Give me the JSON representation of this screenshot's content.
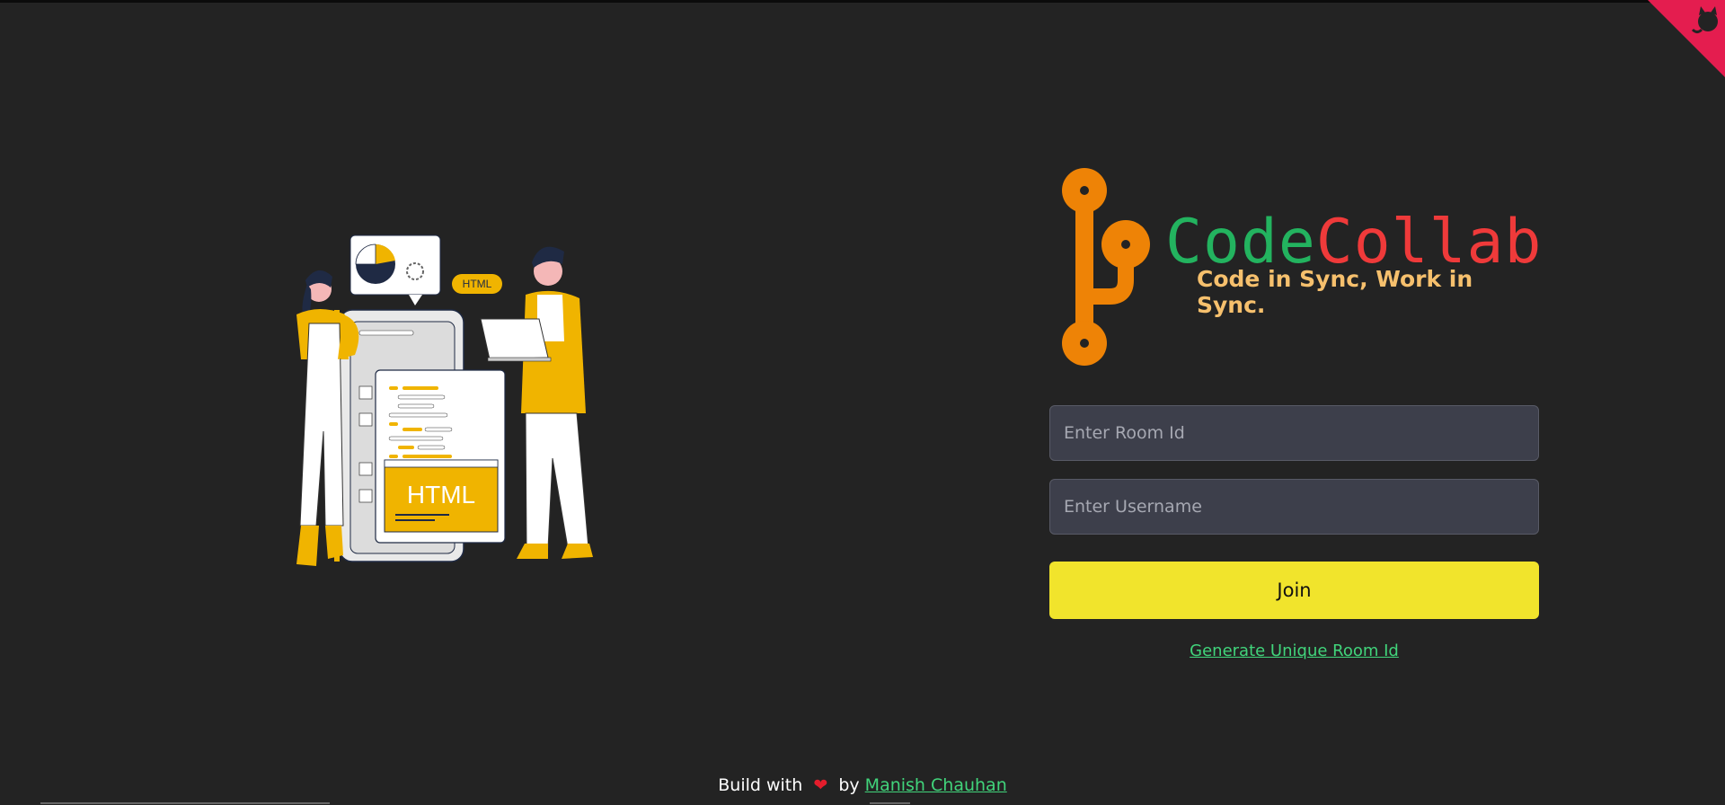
{
  "brand": {
    "name_part1": "Code",
    "name_part2": "Collab",
    "tagline": "Code in Sync, Work in Sync.",
    "colors": {
      "code": "#23b35f",
      "collab": "#ef3a3a",
      "tagline": "#f6c06d",
      "logo": "#ee8306"
    }
  },
  "illustration": {
    "badge_label": "HTML",
    "panel_label": "HTML"
  },
  "form": {
    "room_placeholder": "Enter Room Id",
    "username_placeholder": "Enter Username",
    "join_label": "Join",
    "generate_label": "Generate Unique Room Id"
  },
  "footer": {
    "prefix": "Build with",
    "heart": "❤",
    "by": "by",
    "author": "Manish Chauhan"
  },
  "corner": {
    "icon": "github-octocat-icon",
    "color": "#e41d4f"
  }
}
